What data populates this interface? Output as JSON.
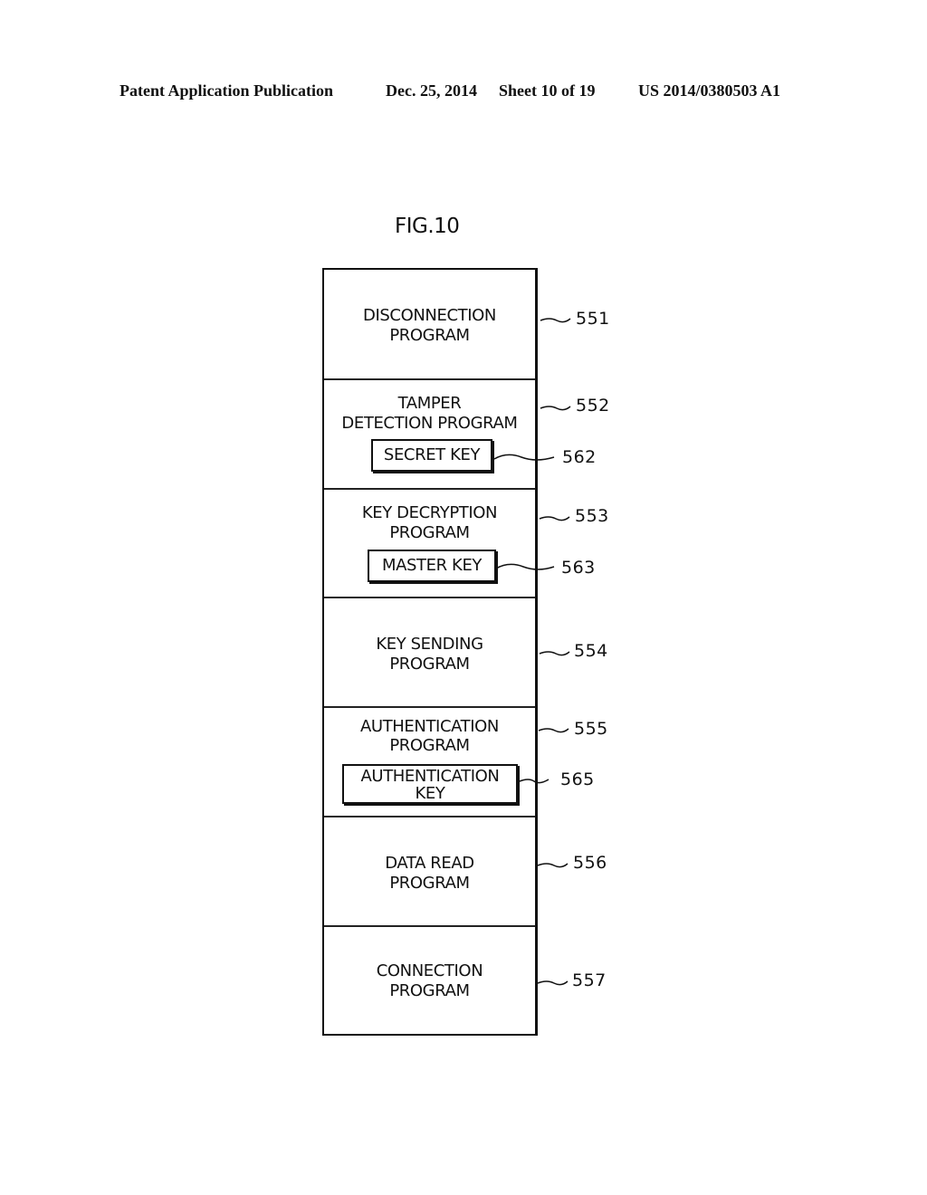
{
  "header": {
    "publication": "Patent Application Publication",
    "date": "Dec. 25, 2014",
    "sheet": "Sheet 10 of 19",
    "number": "US 2014/0380503 A1"
  },
  "figure": {
    "title": "FIG.10",
    "blocks": [
      {
        "label_lines": [
          "DISCONNECTION",
          "PROGRAM"
        ],
        "ref": "551"
      },
      {
        "label_lines": [
          "TAMPER",
          "DETECTION PROGRAM"
        ],
        "ref": "552",
        "inner": {
          "label": "SECRET KEY",
          "ref": "562"
        }
      },
      {
        "label_lines": [
          "KEY DECRYPTION",
          "PROGRAM"
        ],
        "ref": "553",
        "inner": {
          "label": "MASTER KEY",
          "ref": "563"
        }
      },
      {
        "label_lines": [
          "KEY SENDING",
          "PROGRAM"
        ],
        "ref": "554"
      },
      {
        "label_lines": [
          "AUTHENTICATION",
          "PROGRAM"
        ],
        "ref": "555",
        "inner": {
          "label_lines": [
            "AUTHENTICATION",
            "KEY"
          ],
          "ref": "565"
        }
      },
      {
        "label_lines": [
          "DATA READ",
          "PROGRAM"
        ],
        "ref": "556"
      },
      {
        "label_lines": [
          "CONNECTION",
          "PROGRAM"
        ],
        "ref": "557"
      }
    ]
  }
}
